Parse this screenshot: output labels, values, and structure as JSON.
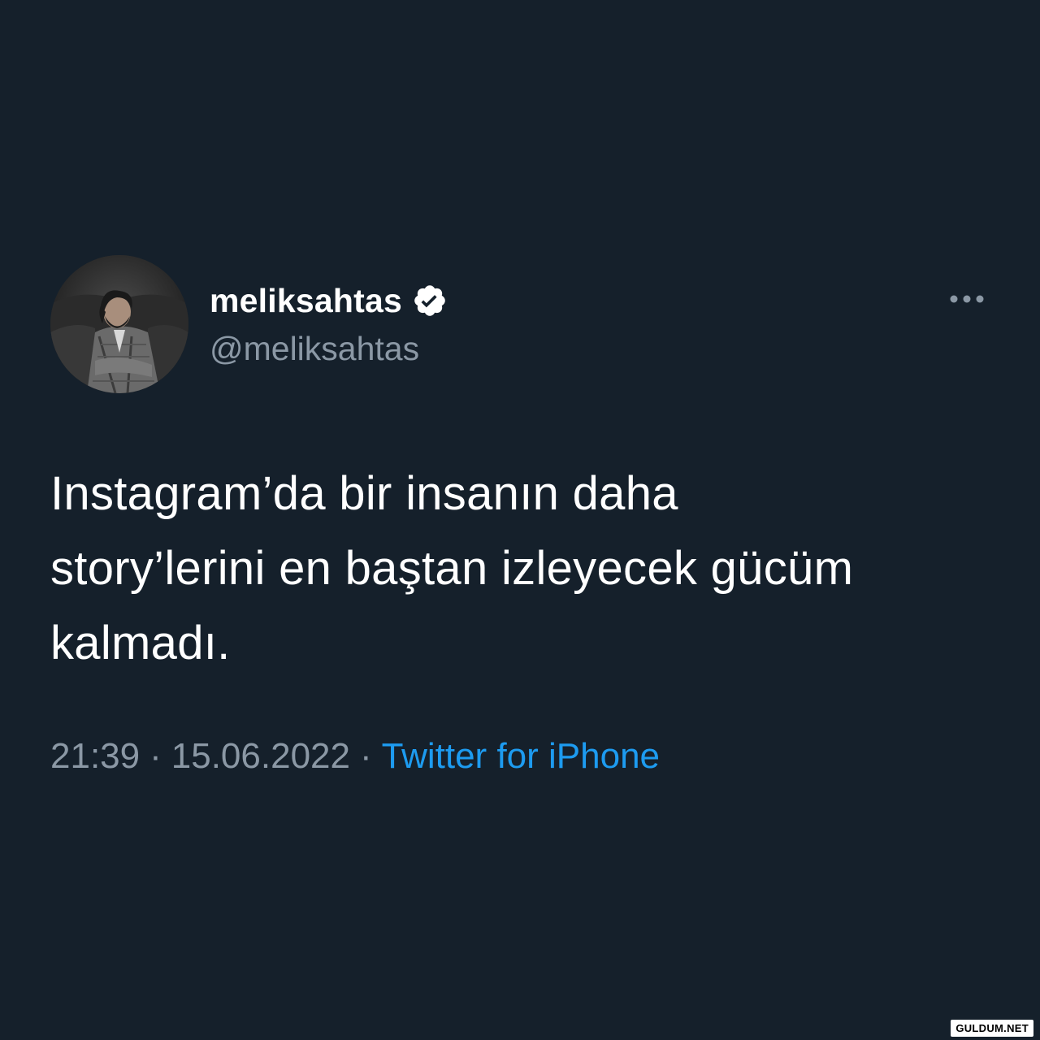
{
  "author": {
    "display_name": "meliksahtas",
    "handle": "@meliksahtas",
    "verified": true,
    "avatar_icon": "profile-photo"
  },
  "tweet": {
    "text": "Instagram’da bir insanın daha\nstory’lerini en baştan izleyecek gücüm\nkalmadı."
  },
  "meta": {
    "time": "21:39",
    "separator": "·",
    "date": "15.06.2022",
    "source": "Twitter for iPhone"
  },
  "icons": {
    "verified": "verified-badge-icon",
    "more": "more-options-icon"
  },
  "colors": {
    "background": "#15202b",
    "text": "#ffffff",
    "secondary_text": "#8b98a5",
    "link": "#1d9bf0"
  },
  "watermark": {
    "text": "GULDUM.NET"
  }
}
